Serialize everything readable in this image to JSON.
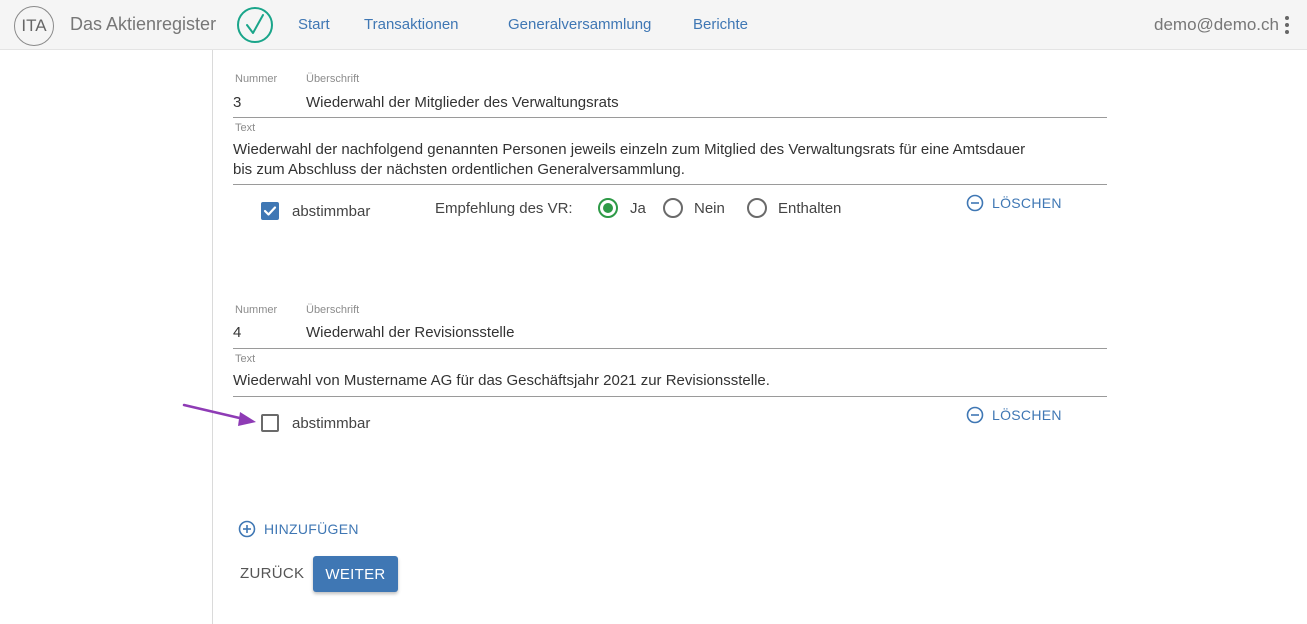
{
  "header": {
    "logo_text": "ITA",
    "app_name": "Das Aktienregister",
    "nav": {
      "start": "Start",
      "transactions": "Transaktionen",
      "general_assembly": "Generalversammlung",
      "reports": "Berichte"
    },
    "user_email": "demo@demo.ch"
  },
  "agenda_items": [
    {
      "number_label": "Nummer",
      "number": "3",
      "title_label": "Überschrift",
      "title": "Wiederwahl der Mitglieder des Verwaltungsrats",
      "text_label": "Text",
      "text_line1": "Wiederwahl der nachfolgend genannten Personen jeweils einzeln zum Mitglied des Verwaltungsrats für eine Amtsdauer",
      "text_line2": "bis zum Abschluss der nächsten ordentlichen Generalversammlung.",
      "votable_label": "abstimmbar",
      "votable": true,
      "recommendation_label": "Empfehlung des VR:",
      "options": [
        "Ja",
        "Nein",
        "Enthalten"
      ],
      "selected_option": "Ja",
      "delete_label": "LÖSCHEN"
    },
    {
      "number_label": "Nummer",
      "number": "4",
      "title_label": "Überschrift",
      "title": "Wiederwahl der Revisionsstelle",
      "text_label": "Text",
      "text_line1": "Wiederwahl von Mustername AG für das Geschäftsjahr 2021 zur Revisionsstelle.",
      "votable_label": "abstimmbar",
      "votable": false,
      "delete_label": "LÖSCHEN"
    }
  ],
  "actions": {
    "add_label": "HINZUFÜGEN",
    "back_label": "ZURÜCK",
    "next_label": "WEITER"
  },
  "colors": {
    "accent_blue": "#3f77b4",
    "radio_green": "#2e9a47",
    "logo_check_teal": "#1aa58a",
    "annotation_purple": "#8e3bb5"
  }
}
